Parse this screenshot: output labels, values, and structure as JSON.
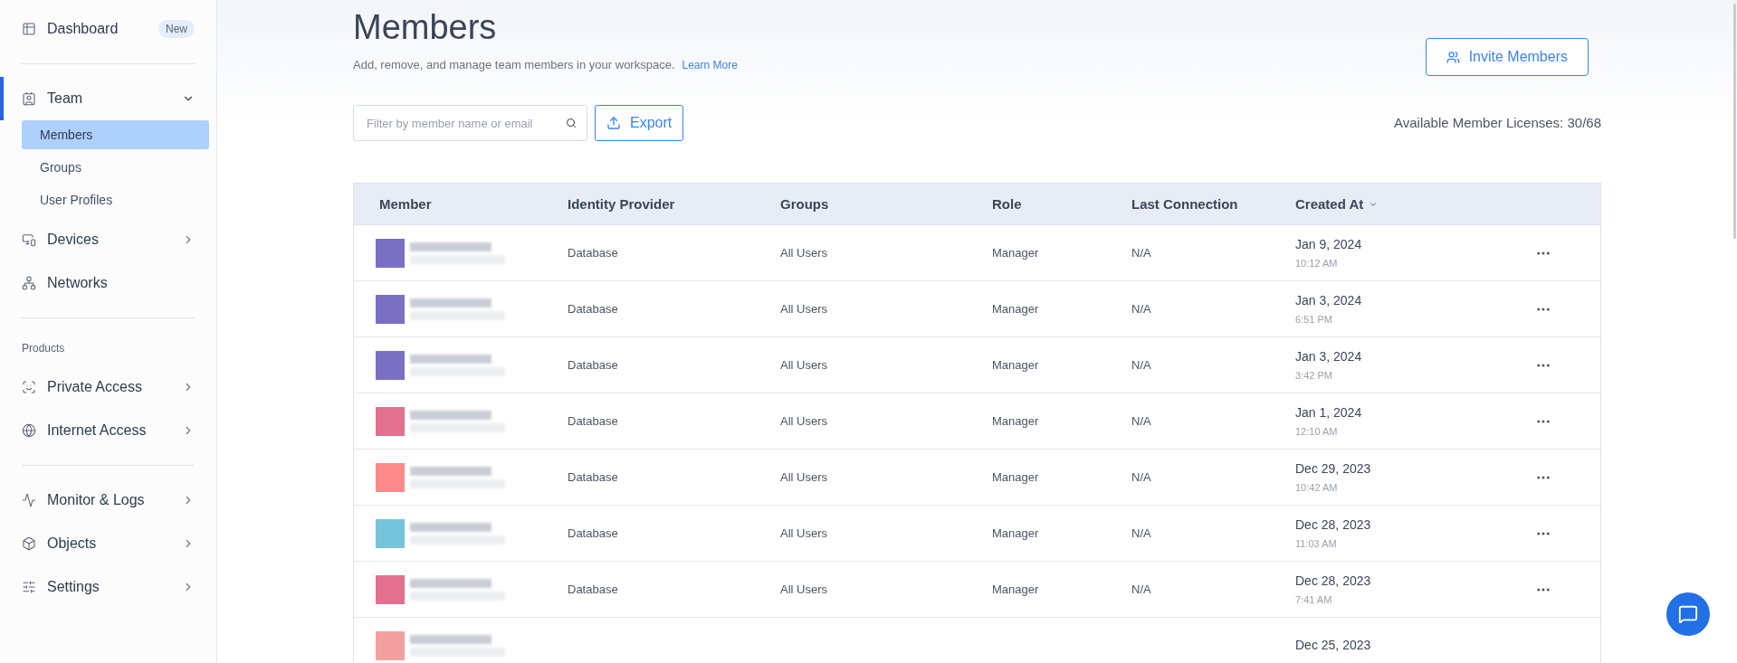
{
  "sidebar": {
    "groups": [
      {
        "items": [
          {
            "label": "Dashboard",
            "badge": "New",
            "selected": false
          }
        ]
      },
      {
        "items": [
          {
            "label": "Team",
            "selected": true,
            "expanded": true,
            "children": [
              {
                "label": "Members",
                "selected": true
              },
              {
                "label": "Groups",
                "selected": false
              },
              {
                "label": "User Profiles",
                "selected": false
              }
            ]
          },
          {
            "label": "Devices",
            "selected": false,
            "expanded": false
          },
          {
            "label": "Networks",
            "selected": false
          }
        ]
      },
      {
        "heading": "Products",
        "items": [
          {
            "label": "Private Access",
            "selected": false,
            "expanded": false
          },
          {
            "label": "Internet Access",
            "selected": false,
            "expanded": false
          }
        ]
      },
      {
        "items": [
          {
            "label": "Monitor & Logs",
            "selected": false,
            "expanded": false
          },
          {
            "label": "Objects",
            "selected": false,
            "expanded": false
          },
          {
            "label": "Settings",
            "selected": false,
            "expanded": false
          }
        ]
      }
    ]
  },
  "header": {
    "title": "Members",
    "subtitle": "Add, remove, and manage team members in your workspace.",
    "link": "Learn More",
    "invite_button": "Invite Members"
  },
  "toolbar": {
    "search": {
      "placeholder": "Filter by member name or email"
    },
    "export_button": "Export",
    "licenses": "Available Member Licenses: 30/68"
  },
  "table": {
    "columns": [
      {
        "label": "Member",
        "sorted": false
      },
      {
        "label": "Identity Provider",
        "sorted": false
      },
      {
        "label": "Groups",
        "sorted": false
      },
      {
        "label": "Role",
        "sorted": false
      },
      {
        "label": "Last Connection",
        "sorted": false
      },
      {
        "label": "Created At",
        "sorted": true
      }
    ],
    "rows": [
      {
        "color": "#7b6fc4",
        "identity_provider": "Database",
        "groups": "All Users",
        "role": "Manager",
        "last_connection": "N/A",
        "created_date": "Jan 9, 2024",
        "created_time": "10:12 AM"
      },
      {
        "color": "#7b6fc4",
        "identity_provider": "Database",
        "groups": "All Users",
        "role": "Manager",
        "last_connection": "N/A",
        "created_date": "Jan 3, 2024",
        "created_time": "6:51 PM"
      },
      {
        "color": "#7b6fc4",
        "identity_provider": "Database",
        "groups": "All Users",
        "role": "Manager",
        "last_connection": "N/A",
        "created_date": "Jan 3, 2024",
        "created_time": "3:42 PM"
      },
      {
        "color": "#e3708f",
        "identity_provider": "Database",
        "groups": "All Users",
        "role": "Manager",
        "last_connection": "N/A",
        "created_date": "Jan 1, 2024",
        "created_time": "12:10 AM"
      },
      {
        "color": "#ff8a8a",
        "identity_provider": "Database",
        "groups": "All Users",
        "role": "Manager",
        "last_connection": "N/A",
        "created_date": "Dec 29, 2023",
        "created_time": "10:42 AM"
      },
      {
        "color": "#76c3dc",
        "identity_provider": "Database",
        "groups": "All Users",
        "role": "Manager",
        "last_connection": "N/A",
        "created_date": "Dec 28, 2023",
        "created_time": "11:03 AM"
      },
      {
        "color": "#e3708f",
        "identity_provider": "Database",
        "groups": "All Users",
        "role": "Manager",
        "last_connection": "N/A",
        "created_date": "Dec 28, 2023",
        "created_time": "7:41 AM"
      },
      {
        "color": "#f5a0a0",
        "created_date": "Dec 25, 2023"
      }
    ]
  }
}
